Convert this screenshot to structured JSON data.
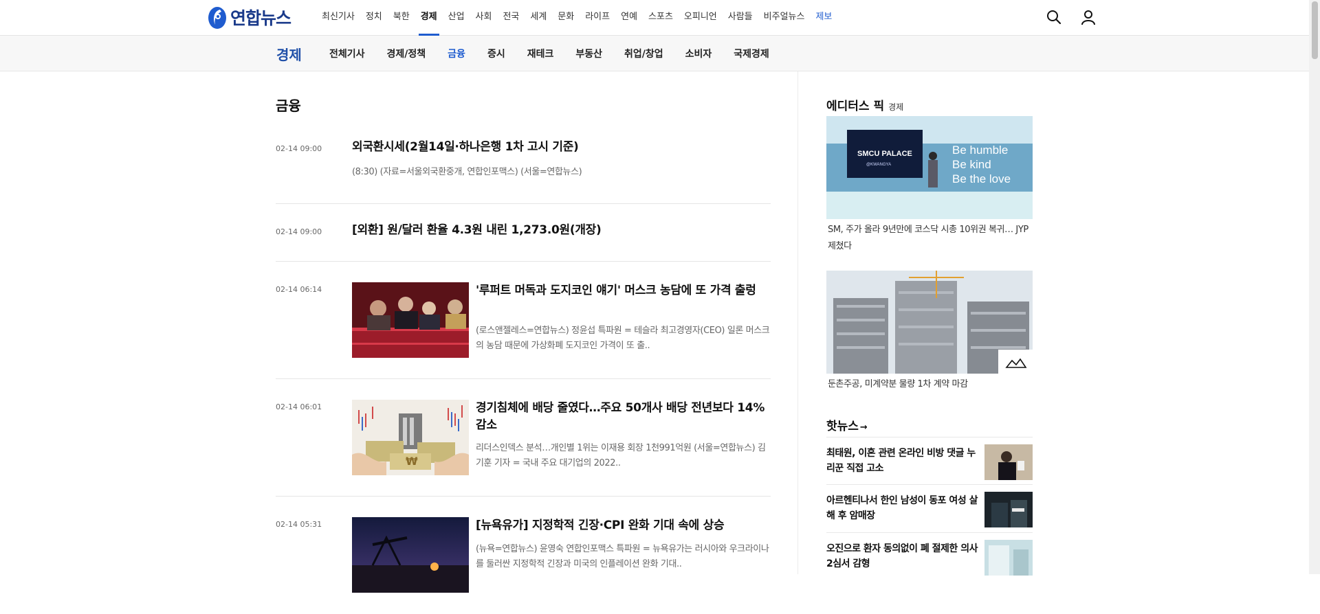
{
  "site": {
    "logo_text": "연합뉴스"
  },
  "gnb": {
    "items": [
      "최신기사",
      "정치",
      "북한",
      "경제",
      "산업",
      "사회",
      "전국",
      "세계",
      "문화",
      "라이프",
      "연예",
      "스포츠",
      "오피니언",
      "사람들",
      "비주얼뉴스",
      "제보"
    ],
    "active_index": 3,
    "report_index": 15,
    "icons": [
      "search-icon",
      "user-icon"
    ]
  },
  "lnb": {
    "title": "경제",
    "items": [
      "전체기사",
      "경제/정책",
      "금융",
      "증시",
      "재테크",
      "부동산",
      "취업/창업",
      "소비자",
      "국제경제"
    ],
    "active_index": 2
  },
  "main": {
    "section_title": "금융",
    "articles": [
      {
        "time": "02-14 09:00",
        "title": "외국환시세(2월14일·하나은행 1차 고시 기준)",
        "lead": "(8:30) (자료=서울외국환중개, 연합인포맥스) (서울=연합뉴스)",
        "thumb": ""
      },
      {
        "time": "02-14 09:00",
        "title": "[외환] 원/달러 환율 4.3원 내린 1,273.0원(개장)",
        "lead": "",
        "thumb": ""
      },
      {
        "time": "02-14 06:14",
        "title": "'루퍼트 머독과 도지코인 얘기' 머스크 농담에 또 가격 출렁",
        "lead": "(로스앤젤레스=연합뉴스) 정윤섭 특파원 = 테슬라 최고경영자(CEO) 일론 머스크의 농담 때문에 가상화폐 도지코인 가격이 또 출..",
        "thumb": "stadium-photo"
      },
      {
        "time": "02-14 06:01",
        "title": "경기침체에 배당 줄였다…주요 50개사 배당 전년보다 14% 감소",
        "lead": "리더스인덱스 분석…개인별 1위는 이재용 회장 1천991억원 (서울=연합뉴스) 김기훈 기자 = 국내 주요 대기업의 2022..",
        "thumb": "dividend-illustration"
      },
      {
        "time": "02-14 05:31",
        "title": "[뉴욕유가] 지정학적 긴장·CPI 완화 기대 속에 상승",
        "lead": "(뉴욕=연합뉴스) 윤영숙 연합인포맥스 특파원 = 뉴욕유가는 러시아와 우크라이나를 둘러싼 지정학적 긴장과 미국의 인플레이션 완화 기대..",
        "thumb": "oil-pump-photo"
      }
    ]
  },
  "aside": {
    "editors_pick": {
      "title": "에디터스 픽",
      "tag": "경제",
      "items": [
        {
          "caption": "SM, 주가 올라 9년만에 코스닥 시총 10위권 복귀… JYP 제쳤다",
          "image_text": [
            "Be humble",
            "Be kind",
            "Be the love",
            "SMCU PALACE",
            "@KWANGYA"
          ]
        },
        {
          "caption": "둔촌주공, 미계약분 물량 1차 계약 마감",
          "image_text": []
        }
      ]
    },
    "hot_news": {
      "title": "핫뉴스",
      "items": [
        {
          "text": "최태원, 이혼 관련 온라인 비방 댓글 누리꾼 직접 고소"
        },
        {
          "text": "아르헨티나서 한인 남성이 동포 여성 살해 후 암매장"
        },
        {
          "text": "오진으로 환자 동의없이 폐 절제한 의사 2심서 감형"
        }
      ]
    }
  },
  "colors": {
    "accent": "#1f5ccf",
    "brand": "#1a3a8a"
  }
}
